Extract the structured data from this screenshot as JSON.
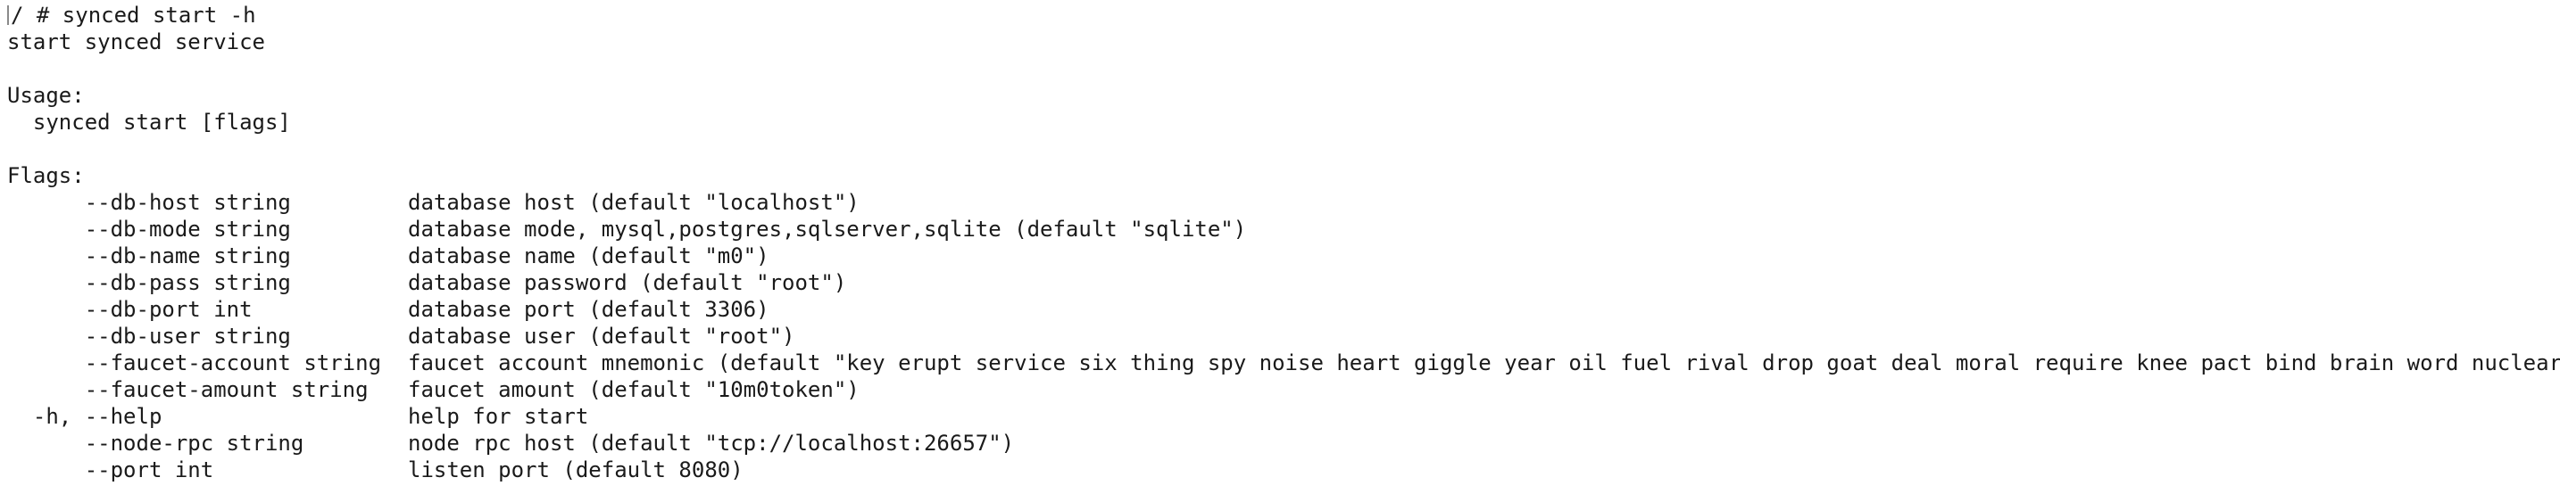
{
  "terminal": {
    "prompt": "/ # ",
    "command": "synced start -h",
    "description": "start synced service",
    "usage_header": "Usage:",
    "usage_line": "  synced start [flags]",
    "flags_header": "Flags:",
    "flags": [
      {
        "name": "      --db-host string",
        "desc": "database host (default \"localhost\")"
      },
      {
        "name": "      --db-mode string",
        "desc": "database mode, mysql,postgres,sqlserver,sqlite (default \"sqlite\")"
      },
      {
        "name": "      --db-name string",
        "desc": "database name (default \"m0\")"
      },
      {
        "name": "      --db-pass string",
        "desc": "database password (default \"root\")"
      },
      {
        "name": "      --db-port int",
        "desc": "database port (default 3306)"
      },
      {
        "name": "      --db-user string",
        "desc": "database user (default \"root\")"
      },
      {
        "name": "      --faucet-account string",
        "desc": "faucet account mnemonic (default \"key erupt service six thing spy noise heart giggle year oil fuel rival drop goat deal moral require knee pact bind brain word nuclear\")"
      },
      {
        "name": "      --faucet-amount string",
        "desc": "faucet amount (default \"10m0token\")"
      },
      {
        "name": "  -h, --help",
        "desc": "help for start"
      },
      {
        "name": "      --node-rpc string",
        "desc": "node rpc host (default \"tcp://localhost:26657\")"
      },
      {
        "name": "      --port int",
        "desc": "listen port (default 8080)"
      }
    ]
  }
}
